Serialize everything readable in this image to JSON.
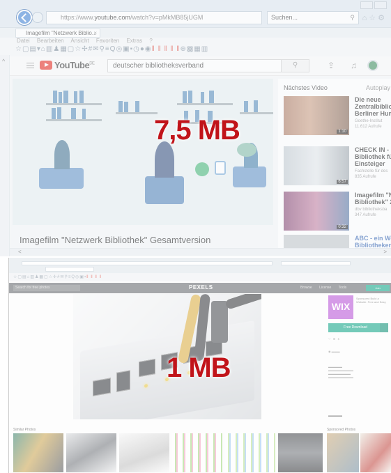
{
  "top": {
    "browser": {
      "url_scheme": "https://www.",
      "url_host": "youtube.com",
      "url_path": "/watch?v=pMkMB85jUGM",
      "search_placeholder": "Suchen...",
      "tab_title": "Imagefilm \"Netzwerk Biblio...",
      "menu": [
        "Datei",
        "Bearbeiten",
        "Ansicht",
        "Favoriten",
        "Extras",
        "?"
      ]
    },
    "youtube": {
      "logo_text": "YouTube",
      "logo_sup": "DE",
      "search_value": "deutscher bibliotheksverband",
      "video_title": "Imagefilm \"Netzwerk Bibliothek\" Gesamtversion"
    },
    "overlay_label": "7,5 MB",
    "sidebar": {
      "heading": "Nächstes Video",
      "autoplay": "Autoplay",
      "items": [
        {
          "title_l1": "Die neue",
          "title_l2": "Zentralbibliot",
          "title_l3": "Berliner Humb",
          "sub_l1": "Goethe-Institut",
          "sub_l2": "11.612 Aufrufe",
          "duration": "1:10"
        },
        {
          "title_l1": "CHECK IN -",
          "title_l2": "Bibliothek für",
          "title_l3": "Einsteiger",
          "sub_l1": "Fachstelle für des",
          "sub_l2": "835 Aufrufe",
          "duration": "6:57"
        },
        {
          "title_l1": "Imagefilm \"N",
          "title_l2": "Bibliothek\" 20",
          "title_l3": "",
          "sub_l1": "dbv bibliotheksba",
          "sub_l2": "347 Aufrufe",
          "duration": "0:32"
        },
        {
          "title_l1": "ABC - ein Web",
          "title_l2": "Bibliotheken",
          "title_l3": "",
          "sub_l1": "",
          "sub_l2": "",
          "duration": ""
        }
      ]
    }
  },
  "bottom": {
    "pexels": {
      "logo": "PEXELS",
      "search_placeholder": "Search for free photos",
      "nav": [
        "Browse",
        "License",
        "Tools"
      ],
      "join_label": "Join",
      "ad_brand": "WIX",
      "ad_text": "Sponsored Build a Website. Free and Easy",
      "download_label": "Free Download",
      "similar_heading": "Similar Photos",
      "sponsored_heading": "Sponsored Photos"
    },
    "overlay_label": "1 MB"
  },
  "colors": {
    "overlay_red": "#c1141a",
    "youtube_red": "#e62117",
    "pexels_green": "#05a081",
    "wix_purple": "#b44bd5"
  }
}
